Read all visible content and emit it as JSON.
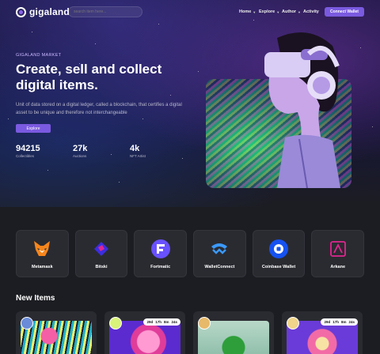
{
  "header": {
    "logo_text": "gigaland",
    "search_placeholder": "search item here...",
    "nav": [
      {
        "label": "Home"
      },
      {
        "label": "Explore"
      },
      {
        "label": "Author"
      },
      {
        "label": "Activity"
      }
    ],
    "connect_label": "Connect Wallet"
  },
  "hero": {
    "eyebrow": "GIGALAND MARKET",
    "headline": "Create, sell and collect digital items.",
    "description": "Unit of data stored on a digital ledger, called a blockchain, that certifies a digital asset to be unique and therefore not interchangeable",
    "explore_label": "Explore",
    "stats": [
      {
        "value": "94215",
        "label": "Collectibles"
      },
      {
        "value": "27k",
        "label": "Auctions"
      },
      {
        "value": "4k",
        "label": "NFT Artist"
      }
    ]
  },
  "wallets": [
    {
      "name": "Metamask",
      "icon": "fox-icon",
      "color": "#f6851b"
    },
    {
      "name": "Bitski",
      "icon": "bitski-icon",
      "color": "#3b2ee0"
    },
    {
      "name": "Fortmatic",
      "icon": "fortmatic-icon",
      "color": "#6851ff"
    },
    {
      "name": "WalletConnect",
      "icon": "walletconnect-icon",
      "color": "#3b99fc"
    },
    {
      "name": "Coinbase Wallet",
      "icon": "coinbase-icon",
      "color": "#1652f0"
    },
    {
      "name": "Arkane",
      "icon": "arkane-icon",
      "color": "#e0268f"
    }
  ],
  "new_items": {
    "title": "New Items",
    "cards": [
      {
        "countdown": null
      },
      {
        "countdown": [
          "29d",
          "17h",
          "8m",
          "24s"
        ]
      },
      {
        "countdown": null
      },
      {
        "countdown": [
          "29d",
          "17h",
          "8m",
          "24s"
        ]
      }
    ]
  },
  "colors": {
    "accent": "#7a5ae0",
    "background": "#1c1d22",
    "card": "#2a2b31"
  }
}
